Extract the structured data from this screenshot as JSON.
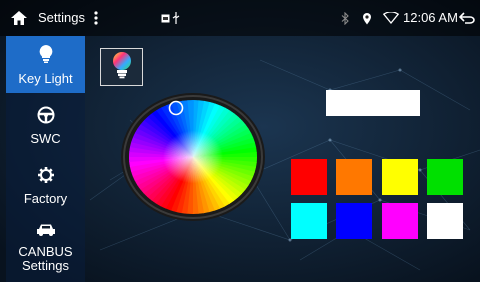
{
  "status_bar": {
    "title": "Settings",
    "time": "12:06 AM",
    "icons": [
      "home-icon",
      "overflow-menu-icon",
      "gallery-icon",
      "usb-icon",
      "bluetooth-icon",
      "location-icon",
      "wifi-icon",
      "back-icon"
    ]
  },
  "sidebar": {
    "items": [
      {
        "label": "Key Light",
        "icon": "bulb-icon",
        "active": true
      },
      {
        "label": "SWC",
        "icon": "steering-wheel-icon",
        "active": false
      },
      {
        "label": "Factory",
        "icon": "gear-icon",
        "active": false
      },
      {
        "label": "CANBUS\nSettings",
        "icon": "car-icon",
        "active": false
      }
    ]
  },
  "key_light": {
    "mode_icon": "rgb-bulb-icon",
    "selected_color": "#ffffff",
    "swatches": [
      "#ff0000",
      "#ff7800",
      "#ffff00",
      "#00e000",
      "#00ffff",
      "#0000ff",
      "#ff00ff",
      "#ffffff"
    ]
  },
  "colors": {
    "accent": "#1e6cc8",
    "background": "#0d1a2a"
  }
}
